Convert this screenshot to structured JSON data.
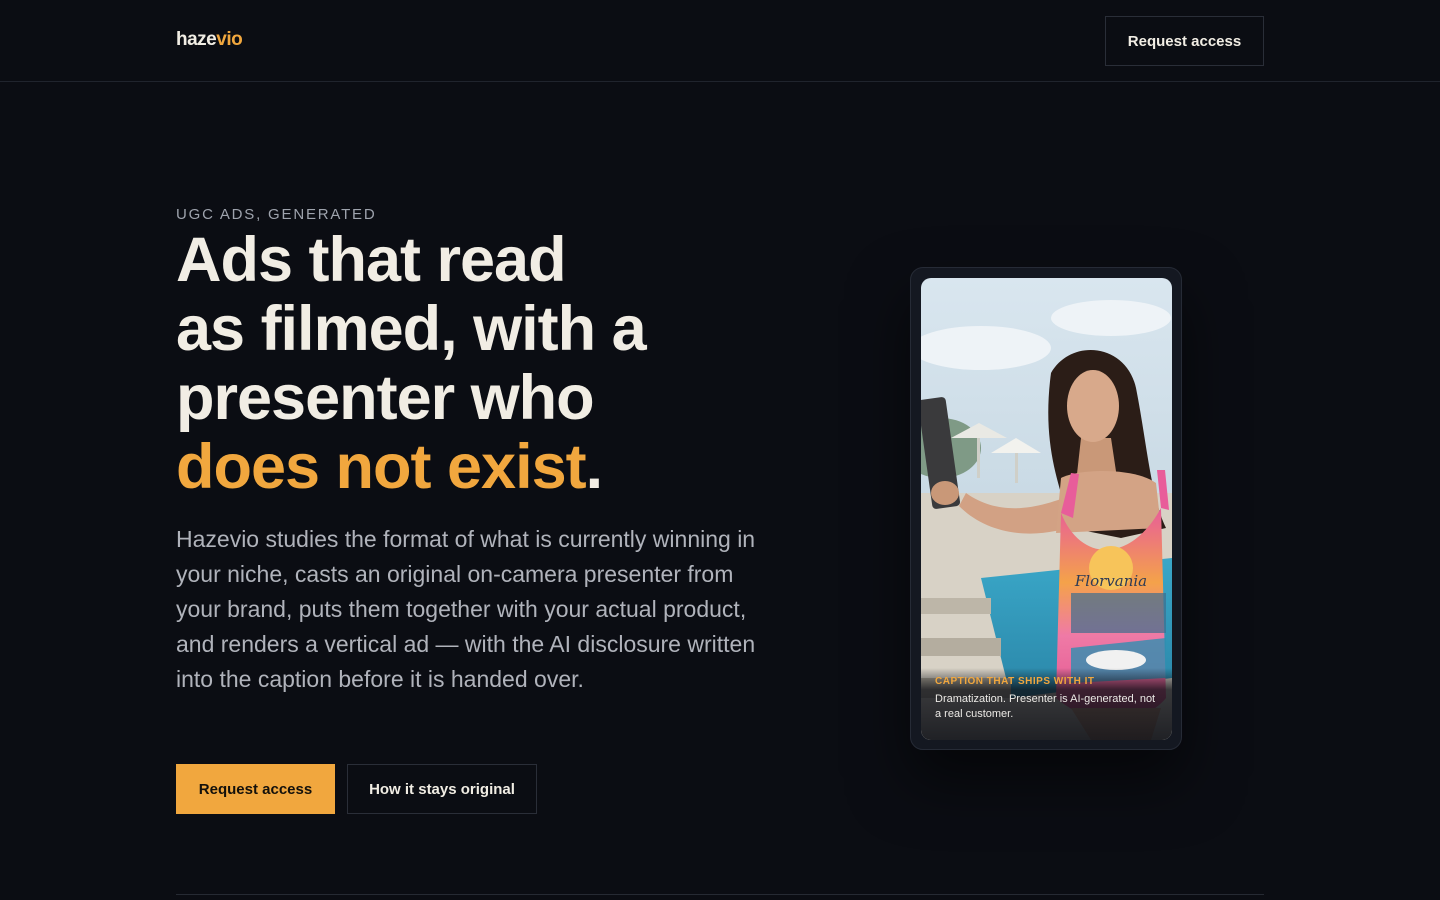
{
  "brand": {
    "name_part1": "haze",
    "name_part2": "vio",
    "accent_color": "#f1a73e",
    "background_color": "#0b0d13"
  },
  "header": {
    "cta_label": "Request access"
  },
  "hero": {
    "eyebrow": "UGC ADS, GENERATED",
    "headline_line1": "Ads that read",
    "headline_line2": "as filmed, with a",
    "headline_line3": "presenter who",
    "headline_highlight": "does not exist",
    "headline_period": ".",
    "lead": "Hazevio studies the format of what is currently winning in your niche, casts an original on-camera presenter from your brand, puts them together with your actual product, and renders a vertical ad — with the AI disclosure written into the caption before it is handed over.",
    "primary_cta": "Request access",
    "secondary_cta": "How it stays original"
  },
  "phone": {
    "shirt_text": "Florvania",
    "caption_label": "CAPTION THAT SHIPS WITH IT",
    "caption_text": "Dramatization. Presenter is AI-generated, not a real customer."
  }
}
